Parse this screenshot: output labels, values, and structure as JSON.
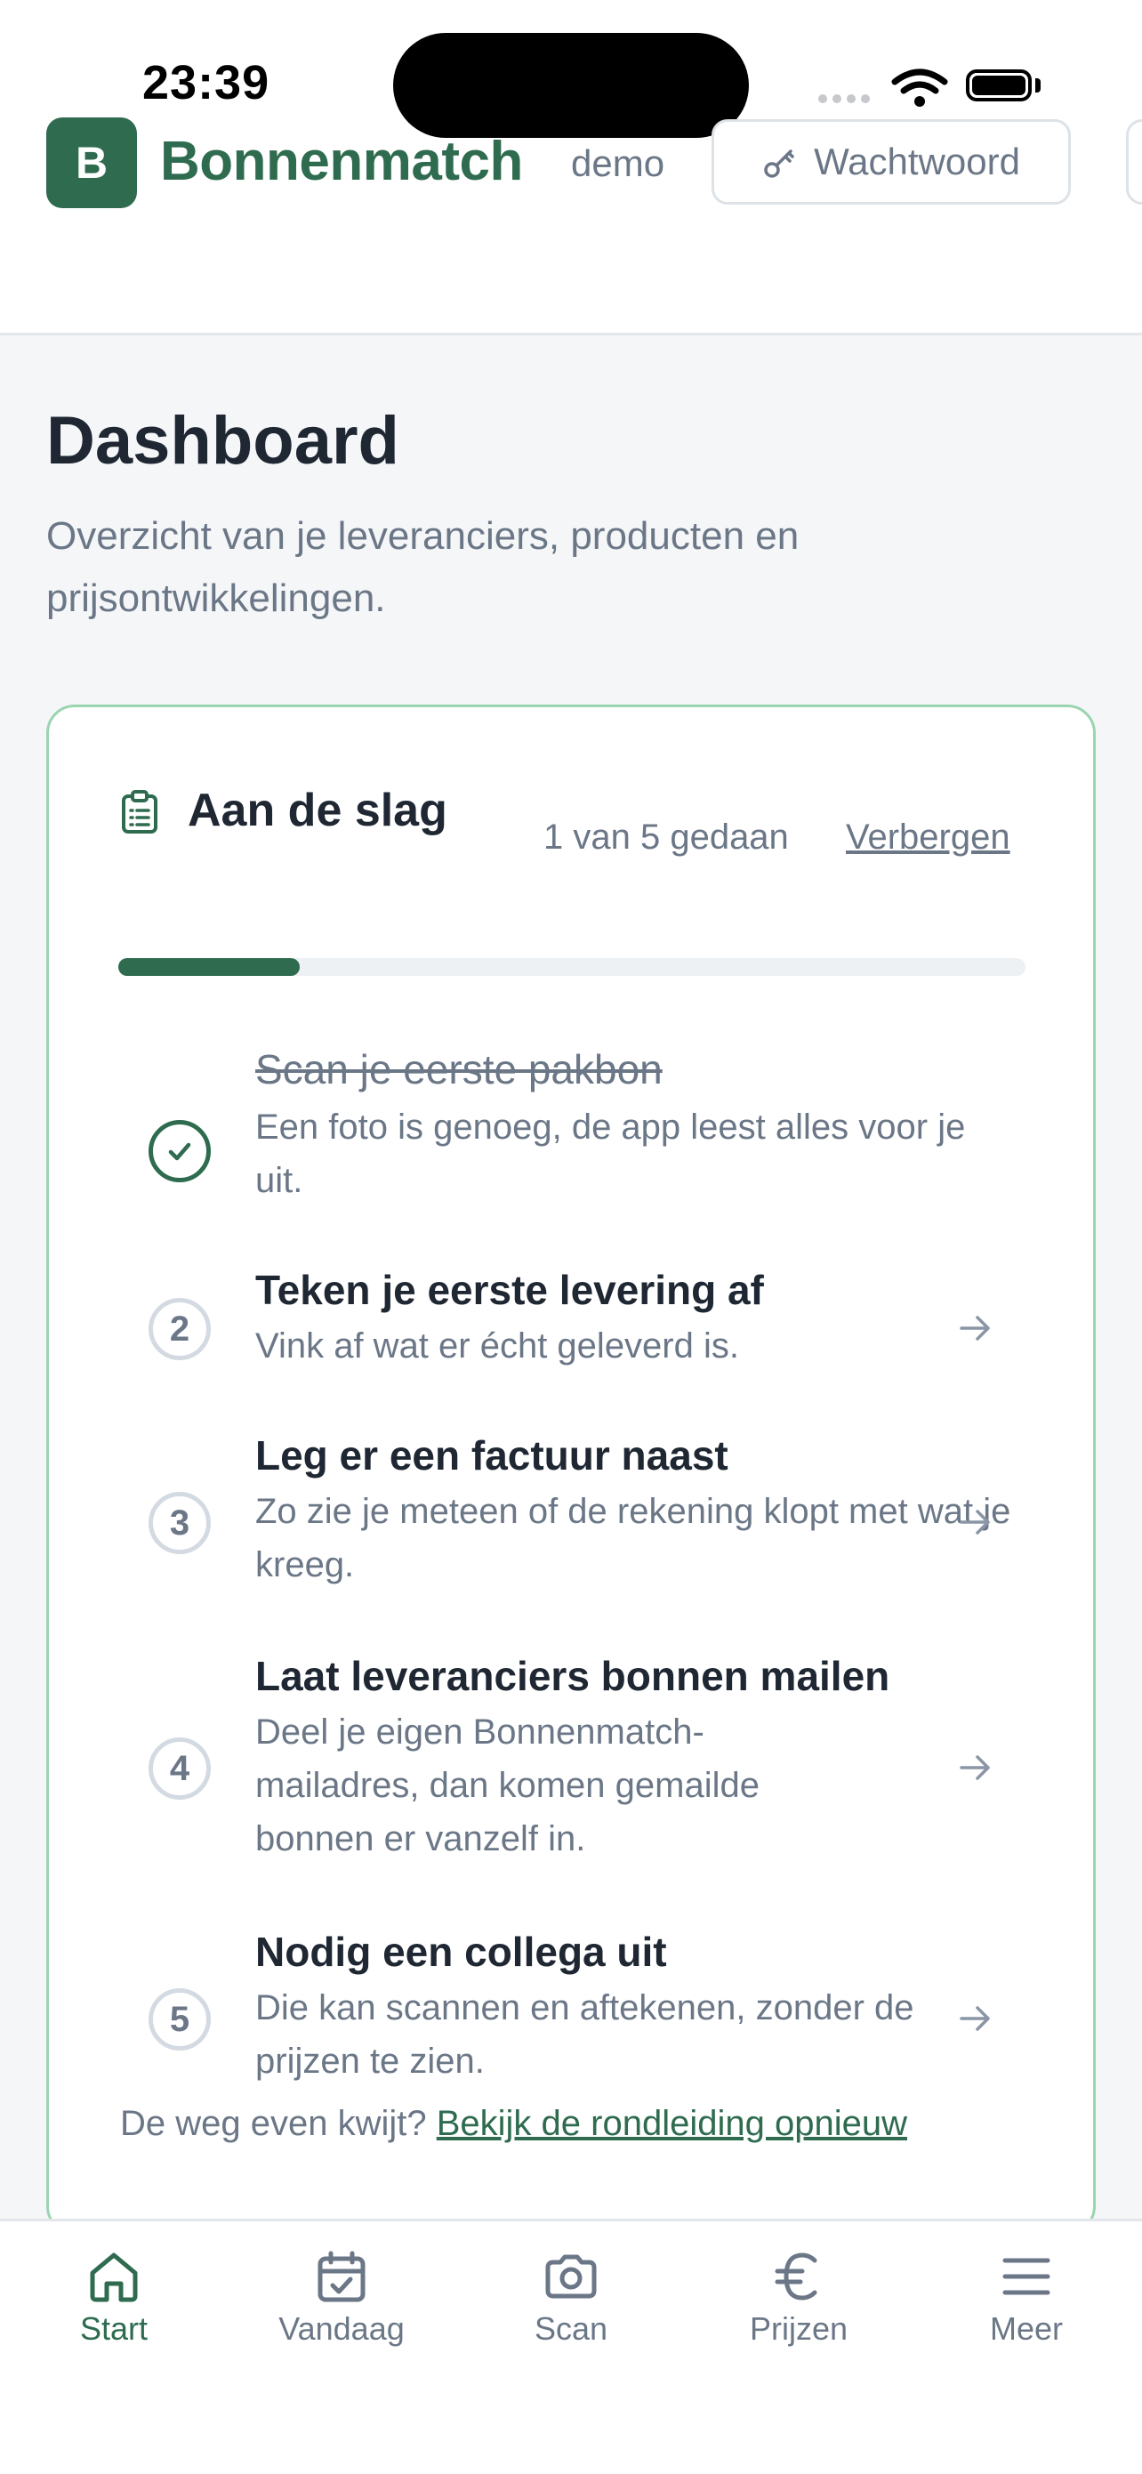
{
  "status_bar": {
    "time": "23:39"
  },
  "header": {
    "logo_letter": "B",
    "brand": "Bonnenmatch",
    "user": "demo",
    "password_button": "Wachtwoord"
  },
  "page": {
    "title": "Dashboard",
    "subtitle": "Overzicht van je leveranciers, producten en prijsontwikkelingen."
  },
  "onboarding": {
    "title": "Aan de slag",
    "progress_text": "1 van 5 gedaan",
    "progress_fraction": 0.2,
    "hide_link": "Verbergen",
    "steps": [
      {
        "number": "1",
        "done": true,
        "title": "Scan je eerste pakbon",
        "desc": "Een foto is genoeg, de app leest alles voor je uit."
      },
      {
        "number": "2",
        "done": false,
        "title": "Teken je eerste levering af",
        "desc": "Vink af wat er écht geleverd is."
      },
      {
        "number": "3",
        "done": false,
        "title": "Leg er een factuur naast",
        "desc": "Zo zie je meteen of de rekening klopt met wat je kreeg."
      },
      {
        "number": "4",
        "done": false,
        "title": "Laat leveranciers bonnen mailen",
        "desc": "Deel je eigen Bonnenmatch-mailadres, dan komen gemailde bonnen er vanzelf in."
      },
      {
        "number": "5",
        "done": false,
        "title": "Nodig een collega uit",
        "desc": "Die kan scannen en aftekenen, zonder de prijzen te zien."
      }
    ],
    "footer_text": "De weg even kwijt?",
    "footer_link": "Bekijk de rondleiding opnieuw"
  },
  "bottom_nav": [
    {
      "label": "Start",
      "icon": "home-icon",
      "active": true
    },
    {
      "label": "Vandaag",
      "icon": "calendar-check-icon",
      "active": false
    },
    {
      "label": "Scan",
      "icon": "camera-icon",
      "active": false
    },
    {
      "label": "Prijzen",
      "icon": "euro-icon",
      "active": false
    },
    {
      "label": "Meer",
      "icon": "menu-icon",
      "active": false
    }
  ],
  "colors": {
    "brand": "#2e6b4f",
    "card_border": "#9bd4b0",
    "muted_text": "#6b7787"
  }
}
